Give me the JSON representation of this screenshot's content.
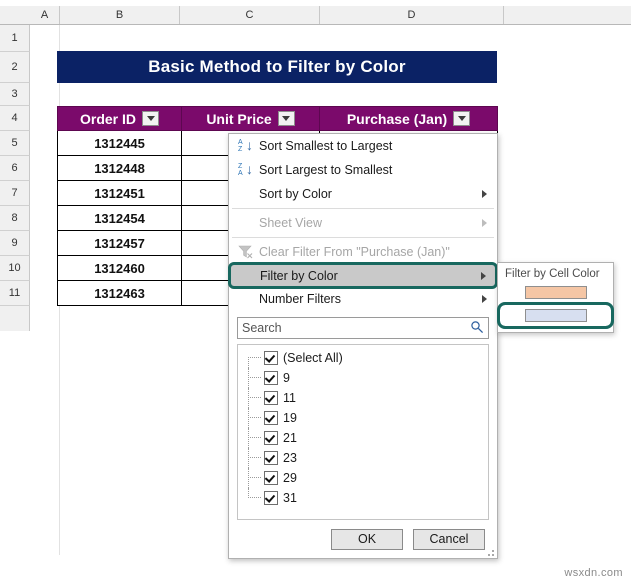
{
  "app": {
    "watermark": "wsxdn.com"
  },
  "sheet": {
    "column_headers": [
      "A",
      "B",
      "C",
      "D"
    ],
    "row_headers": [
      "1",
      "2",
      "3",
      "4",
      "5",
      "6",
      "7",
      "8",
      "9",
      "10",
      "11"
    ]
  },
  "title_banner": {
    "text": "Basic Method to Filter by Color"
  },
  "table": {
    "headers": [
      "Order ID",
      "Unit Price",
      "Purchase (Jan)"
    ],
    "rows": [
      {
        "order_id": "1312445",
        "unit_price": "$",
        "purchase": ""
      },
      {
        "order_id": "1312448",
        "unit_price": "$",
        "purchase": ""
      },
      {
        "order_id": "1312451",
        "unit_price": "$",
        "purchase": ""
      },
      {
        "order_id": "1312454",
        "unit_price": "$",
        "purchase": ""
      },
      {
        "order_id": "1312457",
        "unit_price": "$",
        "purchase": ""
      },
      {
        "order_id": "1312460",
        "unit_price": "$",
        "purchase": ""
      },
      {
        "order_id": "1312463",
        "unit_price": "$",
        "purchase": ""
      }
    ]
  },
  "filter_menu": {
    "items": [
      {
        "label": "Sort Smallest to Largest",
        "icon": "sort-ascending-icon",
        "disabled": false,
        "submenu": false
      },
      {
        "label": "Sort Largest to Smallest",
        "icon": "sort-descending-icon",
        "disabled": false,
        "submenu": false
      },
      {
        "label": "Sort by Color",
        "icon": "",
        "disabled": false,
        "submenu": true
      },
      {
        "label": "Sheet View",
        "icon": "",
        "disabled": true,
        "submenu": true
      },
      {
        "label": "Clear Filter From \"Purchase (Jan)\"",
        "icon": "clear-filter-icon",
        "disabled": true,
        "submenu": false
      },
      {
        "label": "Filter by Color",
        "icon": "",
        "disabled": false,
        "submenu": true,
        "highlighted": true
      },
      {
        "label": "Number Filters",
        "icon": "",
        "disabled": false,
        "submenu": true
      }
    ],
    "search": {
      "placeholder": "Search",
      "value": ""
    },
    "values": [
      {
        "label": "(Select All)",
        "checked": true
      },
      {
        "label": "9",
        "checked": true
      },
      {
        "label": "11",
        "checked": true
      },
      {
        "label": "19",
        "checked": true
      },
      {
        "label": "21",
        "checked": true
      },
      {
        "label": "23",
        "checked": true
      },
      {
        "label": "29",
        "checked": true
      },
      {
        "label": "31",
        "checked": true
      }
    ],
    "buttons": {
      "ok": "OK",
      "cancel": "Cancel"
    }
  },
  "color_submenu": {
    "title": "Filter by Cell Color",
    "swatches": [
      {
        "name": "orange-swatch",
        "color": "#f5c6a5",
        "selected": false
      },
      {
        "name": "blue-swatch",
        "color": "#d7dff0",
        "selected": true
      }
    ]
  },
  "colors": {
    "banner": "#0b2265",
    "table_header": "#7b0a6b",
    "callout": "#18685f",
    "highlight_row": "#c9c9c9"
  }
}
